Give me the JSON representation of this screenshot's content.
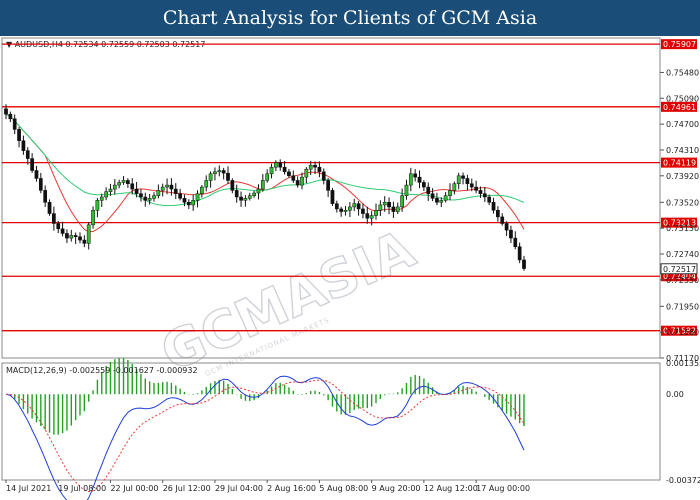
{
  "header": {
    "title": "Chart Analysis for Clients of GCM Asia"
  },
  "chart_data": {
    "type": "candlestick",
    "symbol_info": "AUDUSD,H4  0.72534 0.72559 0.72503 0.72517",
    "current_price": "0.72517",
    "watermark": "GCMASIA",
    "watermark_sub": "GCM INTERNATIONAL MARKETS",
    "price_ylim": [
      0.7117,
      0.76
    ],
    "price_ticks": [
      "0.75480",
      "0.75090",
      "0.74700",
      "0.74310",
      "0.73920",
      "0.73520",
      "0.73130",
      "0.72740",
      "0.72350",
      "0.71950",
      "0.71560",
      "0.71170"
    ],
    "levels": [
      "0.75907",
      "0.74961",
      "0.74119",
      "0.73213",
      "0.72404",
      "0.71582"
    ],
    "x_labels": [
      "14 Jul 2021",
      "19 Jul 08:00",
      "22 Jul 00:00",
      "26 Jul 12:00",
      "29 Jul 04:00",
      "2 Aug 16:00",
      "5 Aug 08:00",
      "9 Aug 20:00",
      "12 Aug 12:00",
      "17 Aug 00:00"
    ],
    "x_label_index": [
      0,
      12,
      24,
      36,
      48,
      60,
      72,
      84,
      96,
      108
    ],
    "close": [
      0.7485,
      0.7478,
      0.7462,
      0.7445,
      0.743,
      0.7418,
      0.74,
      0.7388,
      0.737,
      0.7352,
      0.7335,
      0.732,
      0.7312,
      0.7305,
      0.7298,
      0.7302,
      0.73,
      0.7295,
      0.729,
      0.7318,
      0.734,
      0.7355,
      0.736,
      0.7368,
      0.7372,
      0.7378,
      0.7382,
      0.7385,
      0.738,
      0.7372,
      0.7365,
      0.736,
      0.7355,
      0.7358,
      0.7362,
      0.737,
      0.7375,
      0.7378,
      0.7372,
      0.7365,
      0.7358,
      0.7352,
      0.7348,
      0.7355,
      0.7365,
      0.7375,
      0.7385,
      0.7395,
      0.7398,
      0.74,
      0.7396,
      0.7385,
      0.737,
      0.736,
      0.7355,
      0.7358,
      0.7362,
      0.7366,
      0.7372,
      0.7385,
      0.7395,
      0.7405,
      0.7412,
      0.7405,
      0.7398,
      0.7392,
      0.7385,
      0.7378,
      0.739,
      0.7402,
      0.7408,
      0.7405,
      0.7398,
      0.7385,
      0.737,
      0.735,
      0.7342,
      0.7338,
      0.734,
      0.7345,
      0.735,
      0.7342,
      0.7335,
      0.7328,
      0.7332,
      0.734,
      0.7348,
      0.7352,
      0.7345,
      0.7338,
      0.7345,
      0.7362,
      0.7378,
      0.7395,
      0.739,
      0.7382,
      0.7375,
      0.7365,
      0.7358,
      0.7352,
      0.7355,
      0.7362,
      0.737,
      0.738,
      0.7392,
      0.7388,
      0.738,
      0.7375,
      0.737,
      0.7365,
      0.736,
      0.7352,
      0.734,
      0.733,
      0.732,
      0.731,
      0.7298,
      0.7285,
      0.7265,
      0.7252
    ],
    "ma_fast_color": "#e53935",
    "ma_slow_color": "#2ecc71",
    "level_color": "#e00000",
    "macd": {
      "label": "MACD(12,26,9) -0.002559 -0.001627 -0.000932",
      "ylim": [
        -0.003724,
        0.001355
      ],
      "ticks": [
        "0.001355",
        "0.00",
        "-0.003724"
      ],
      "hist_color": "#22a022",
      "macd_color": "#1f3fd6",
      "signal_color": "#e53935"
    }
  }
}
